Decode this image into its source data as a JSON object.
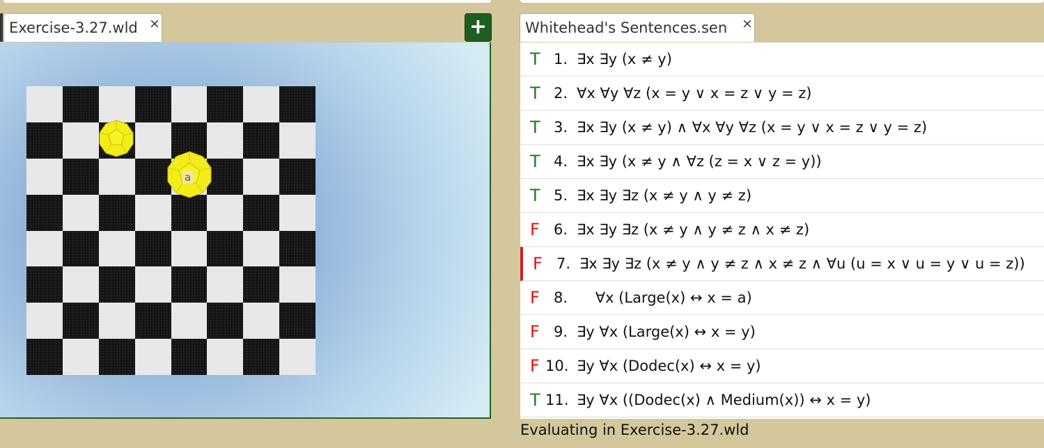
{
  "world_tab": {
    "label": "Exercise-3.27.wld",
    "close": "×"
  },
  "add_button": {
    "label": "+"
  },
  "sentence_tab": {
    "label": "Whitehead's Sentences.sen",
    "close": "×"
  },
  "world": {
    "shapes": [
      {
        "type": "dodecahedron",
        "size": "medium",
        "color": "yellow",
        "label": ""
      },
      {
        "type": "dodecahedron",
        "size": "large",
        "color": "yellow",
        "label": "a"
      }
    ]
  },
  "sentences": [
    {
      "value": "T",
      "num": "1.",
      "text": "∃x ∃y (x ≠ y)"
    },
    {
      "value": "T",
      "num": "2.",
      "text": "∀x ∀y ∀z (x = y ∨ x = z ∨ y = z)"
    },
    {
      "value": "T",
      "num": "3.",
      "text": "∃x ∃y (x ≠ y) ∧ ∀x ∀y ∀z (x = y ∨ x = z ∨ y = z)"
    },
    {
      "value": "T",
      "num": "4.",
      "text": "∃x ∃y (x ≠ y ∧ ∀z (z = x ∨ z = y))"
    },
    {
      "value": "T",
      "num": "5.",
      "text": "∃x ∃y ∃z (x ≠ y ∧ y ≠ z)"
    },
    {
      "value": "F",
      "num": "6.",
      "text": "∃x ∃y ∃z (x ≠ y ∧ y ≠ z ∧ x ≠ z)"
    },
    {
      "value": "F",
      "num": "7.",
      "text": "∃x ∃y ∃z (x ≠ y ∧ y ≠ z ∧ x ≠ z ∧ ∀u (u = x ∨ u = y ∨ u = z))",
      "selected": true
    },
    {
      "value": "F",
      "num": "8.",
      "text": "    ∀x (Large(x) ↔ x = a)"
    },
    {
      "value": "F",
      "num": "9.",
      "text": "∃y ∀x (Large(x) ↔ x = y)"
    },
    {
      "value": "F",
      "num": "10.",
      "text": "∃y ∀x (Dodec(x) ↔ x = y)"
    },
    {
      "value": "T",
      "num": "11.",
      "text": "∃y ∀x ((Dodec(x) ∧ Medium(x)) ↔ x = y)"
    }
  ],
  "status": "Evaluating in Exercise-3.27.wld",
  "colors": {
    "true": "#1f7a1f",
    "false": "#e01010",
    "accent": "#1f5e22",
    "selection": "#d0202a",
    "background": "#d5c79c"
  }
}
